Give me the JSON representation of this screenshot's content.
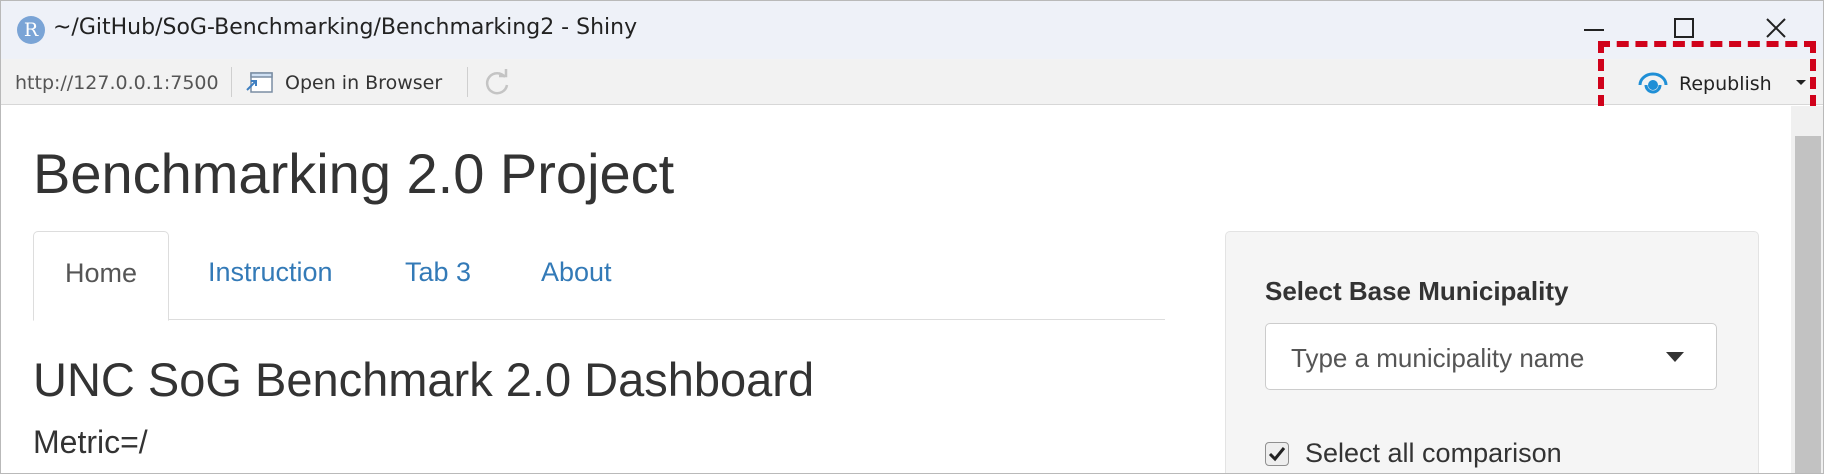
{
  "window": {
    "app_icon_letter": "R",
    "title": "~/GitHub/SoG-Benchmarking/Benchmarking2 - Shiny",
    "controls": [
      "minimize-icon",
      "maximize-icon",
      "close-icon"
    ]
  },
  "toolbar": {
    "url": "http://127.0.0.1:7500",
    "open_in_browser_label": "Open in Browser",
    "open_in_browser_icon": "open-in-browser-icon",
    "refresh_icon": "refresh-icon",
    "republish_label": "Republish",
    "republish_icon": "publish-icon",
    "republish_caret_icon": "caret-down-icon",
    "highlight_color": "#d0021b"
  },
  "app": {
    "title": "Benchmarking 2.0 Project",
    "tabs": [
      {
        "label": "Home",
        "active": true
      },
      {
        "label": "Instruction",
        "active": false
      },
      {
        "label": "Tab 3",
        "active": false
      },
      {
        "label": "About",
        "active": false
      }
    ],
    "dashboard_title": "UNC SoG Benchmark 2.0 Dashboard",
    "metric_text": "Metric=/",
    "link_color": "#337ab7",
    "sidebar": {
      "base_label": "Select Base Municipality",
      "select_placeholder": "Type a municipality name",
      "select_all_label": "Select all comparison",
      "select_all_checked": true
    }
  }
}
